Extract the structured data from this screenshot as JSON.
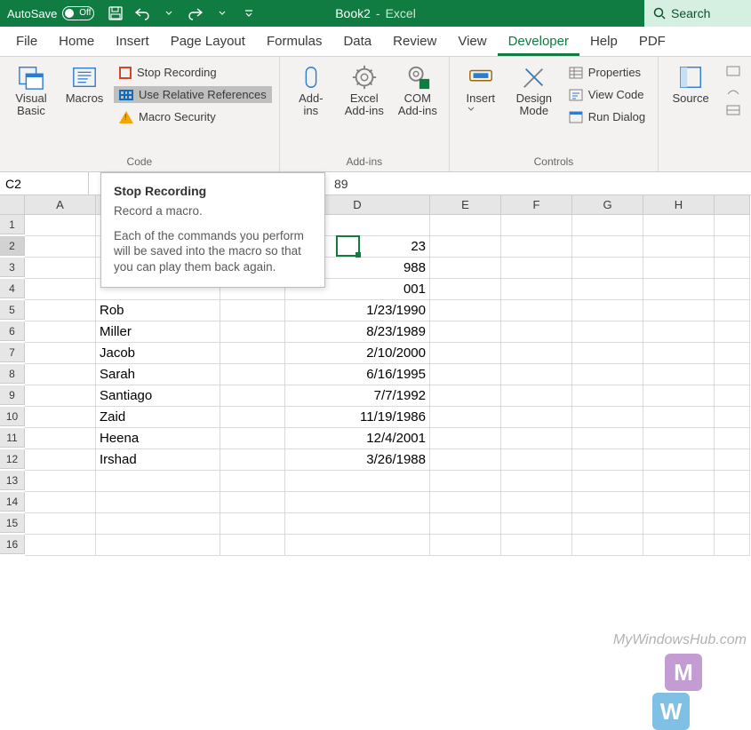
{
  "titlebar": {
    "autosave_label": "AutoSave",
    "autosave_off": "Off",
    "bookname": "Book2",
    "dash": " - ",
    "appname": "Excel",
    "search_label": "Search"
  },
  "tabs": [
    "File",
    "Home",
    "Insert",
    "Page Layout",
    "Formulas",
    "Data",
    "Review",
    "View",
    "Developer",
    "Help",
    "PDF"
  ],
  "active_tab": "Developer",
  "ribbon": {
    "code": {
      "visual_basic": "Visual\nBasic",
      "macros": "Macros",
      "stop_recording": "Stop Recording",
      "use_relative": "Use Relative References",
      "macro_security": "Macro Security",
      "group_label": "Code"
    },
    "addins": {
      "addins": "Add-\nins",
      "excel_addins": "Excel\nAdd-ins",
      "com_addins": "COM\nAdd-ins",
      "group_label": "Add-ins"
    },
    "controls": {
      "insert": "Insert",
      "design_mode": "Design\nMode",
      "properties": "Properties",
      "view_code": "View Code",
      "run_dialog": "Run Dialog",
      "group_label": "Controls"
    },
    "xml": {
      "source": "Source"
    }
  },
  "tooltip": {
    "title": "Stop Recording",
    "line1": "Record a macro.",
    "line2": "Each of the commands you perform will be saved into the macro so that you can play them back again."
  },
  "formula_bar": {
    "namebox": "C2",
    "visible_fx_fragment": "89"
  },
  "columns": [
    "A",
    "B",
    "C",
    "D",
    "E",
    "F",
    "G",
    "H"
  ],
  "selection": {
    "cell": "D2",
    "display": "23"
  },
  "rows": [
    {
      "n": 1,
      "B": "",
      "D": ""
    },
    {
      "n": 2,
      "B": "",
      "D": "23"
    },
    {
      "n": 3,
      "B": "",
      "D": "988"
    },
    {
      "n": 4,
      "B": "",
      "D": "001"
    },
    {
      "n": 5,
      "B": "Rob",
      "D": "1/23/1990"
    },
    {
      "n": 6,
      "B": "Miller",
      "D": "8/23/1989"
    },
    {
      "n": 7,
      "B": "Jacob",
      "D": "2/10/2000"
    },
    {
      "n": 8,
      "B": "Sarah",
      "D": "6/16/1995"
    },
    {
      "n": 9,
      "B": "Santiago",
      "D": "7/7/1992"
    },
    {
      "n": 10,
      "B": "Zaid",
      "D": "11/19/1986"
    },
    {
      "n": 11,
      "B": "Heena",
      "D": "12/4/2001"
    },
    {
      "n": 12,
      "B": "Irshad",
      "D": "3/26/1988"
    },
    {
      "n": 13,
      "B": "",
      "D": ""
    },
    {
      "n": 14,
      "B": "",
      "D": ""
    },
    {
      "n": 15,
      "B": "",
      "D": ""
    },
    {
      "n": 16,
      "B": "",
      "D": ""
    }
  ],
  "watermark": {
    "text": "MyWindowsHub.com",
    "letters": [
      "M",
      "W"
    ]
  }
}
